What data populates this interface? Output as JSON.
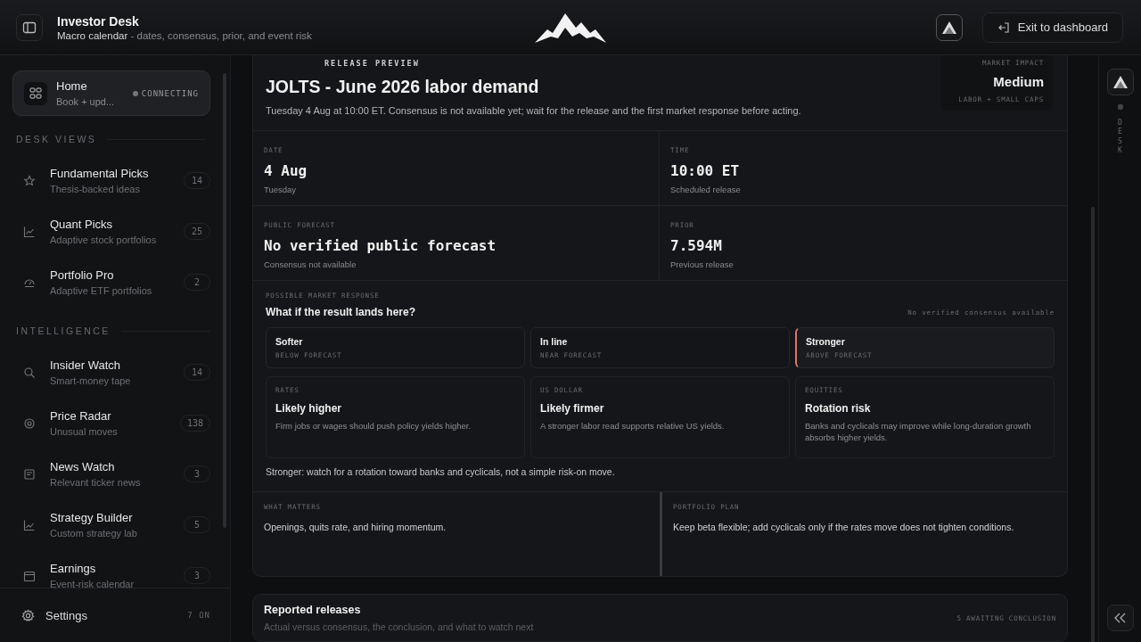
{
  "header": {
    "title": "Investor Desk",
    "subtitle": "**Macro calendar** - dates, consensus, prior, and event risk",
    "exit_button": "Exit to dashboard"
  },
  "sidebar": {
    "home": {
      "title": "Home",
      "subtitle": "Book + upd...",
      "status": "CONNECTING",
      "selected": true
    },
    "sections": [
      {
        "title": "DESK VIEWS",
        "items": [
          {
            "title": "Fundamental Picks",
            "subtitle": "Thesis-backed ideas",
            "count": "14"
          },
          {
            "title": "Quant Picks",
            "subtitle": "Adaptive stock portfolios",
            "count": "25"
          },
          {
            "title": "Portfolio Pro",
            "subtitle": "Adaptive ETF portfolios",
            "count": "2"
          }
        ]
      },
      {
        "title": "INTELLIGENCE",
        "items": [
          {
            "title": "Insider Watch",
            "subtitle": "Smart-money tape",
            "count": "14"
          },
          {
            "title": "Price Radar",
            "subtitle": "Unusual moves",
            "count": "138"
          },
          {
            "title": "News Watch",
            "subtitle": "Relevant ticker news",
            "count": "3"
          },
          {
            "title": "Strategy Builder",
            "subtitle": "Custom strategy lab",
            "count": "5"
          },
          {
            "title": "Earnings",
            "subtitle": "Event-risk calendar",
            "count": "3"
          }
        ]
      }
    ],
    "settings": {
      "label": "Settings",
      "count": "7 ON"
    }
  },
  "release": {
    "eyebrow": "RELEASE PREVIEW",
    "title": "JOLTS - June 2026 labor demand",
    "summary": "Tuesday 4 Aug at 10:00 ET. Consensus is not available yet; wait for the release and the first market response before acting.",
    "impact": {
      "label": "MARKET IMPACT",
      "value": "Medium",
      "note": "LABOR + SMALL CAPS"
    },
    "stats": [
      {
        "label": "DATE",
        "value": "4 Aug",
        "note": "Tuesday"
      },
      {
        "label": "TIME",
        "value": "10:00 ET",
        "note": "Scheduled release"
      },
      {
        "label": "PUBLIC FORECAST",
        "value": "No verified public forecast",
        "note": "Consensus not available"
      },
      {
        "label": "PRIOR",
        "value": "7.594M",
        "note": "Previous release"
      }
    ],
    "response": {
      "eyebrow": "POSSIBLE MARKET RESPONSE",
      "question": "What if the result lands here?",
      "consensus_note": "No verified consensus available",
      "scenarios": [
        {
          "title": "Softer",
          "note": "BELOW FORECAST",
          "selected": false
        },
        {
          "title": "In line",
          "note": "NEAR FORECAST",
          "selected": false
        },
        {
          "title": "Stronger",
          "note": "ABOVE FORECAST",
          "selected": true
        }
      ],
      "impacts": [
        {
          "label": "RATES",
          "title": "Likely higher",
          "text": "Firm jobs or wages should push policy yields higher."
        },
        {
          "label": "US DOLLAR",
          "title": "Likely firmer",
          "text": "A stronger labor read supports relative US yields."
        },
        {
          "label": "EQUITIES",
          "title": "Rotation risk",
          "text": "Banks and cyclicals may improve while long-duration growth absorbs higher yields."
        }
      ],
      "takeaway": "Stronger: watch for a rotation toward banks and cyclicals, not a simple risk-on move."
    },
    "notes": [
      {
        "label": "WHAT MATTERS",
        "text": "Openings, quits rate, and hiring momentum."
      },
      {
        "label": "PORTFOLIO PLAN",
        "text": "Keep beta flexible; add cyclicals only if the rates move does not tighten conditions."
      }
    ]
  },
  "reported": {
    "title": "Reported releases",
    "subtitle": "Actual versus consensus, the conclusion, and what to watch next",
    "status": "5 AWAITING CONCLUSION"
  },
  "rail": {
    "label": "DESK"
  }
}
